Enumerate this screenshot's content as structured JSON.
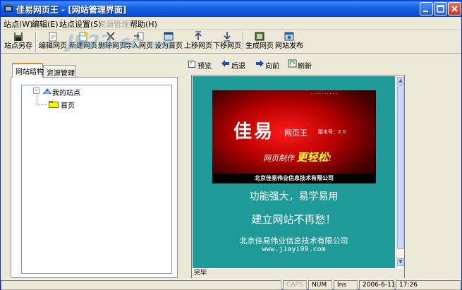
{
  "window": {
    "title": "佳易网页王 - [网站管理界面]",
    "colors": {
      "titlebar": "#0a4fd8",
      "accent": "#e68b2c",
      "preview_bg": "#1f9a98"
    }
  },
  "menu": [
    {
      "label": "站点(W)",
      "disabled": false
    },
    {
      "label": "编辑(E)",
      "disabled": false
    },
    {
      "label": "站点设置(S)",
      "disabled": false
    },
    {
      "label": "资源管理",
      "disabled": true
    },
    {
      "label": "帮助(H)",
      "disabled": false
    }
  ],
  "toolbar": [
    {
      "label": "站点另存",
      "icon": "save-site-icon"
    },
    {
      "label": "编辑网页",
      "icon": "edit-page-icon"
    },
    {
      "label": "新建网页",
      "icon": "new-page-icon"
    },
    {
      "label": "删除网页",
      "icon": "delete-page-icon"
    },
    {
      "label": "导入网页",
      "icon": "import-page-icon"
    },
    {
      "label": "设为首页",
      "icon": "set-home-icon"
    },
    {
      "label": "上移网页",
      "icon": "move-up-icon"
    },
    {
      "label": "下移网页",
      "icon": "move-down-icon"
    },
    {
      "label": "生成网页",
      "icon": "generate-page-icon"
    },
    {
      "label": "网站发布",
      "icon": "publish-site-icon"
    }
  ],
  "watermark": {
    "text": "JS22.cc",
    "sub": "软件园"
  },
  "tabs": [
    {
      "label": "网站结构",
      "active": true
    },
    {
      "label": "资源管理",
      "active": false
    }
  ],
  "tree": {
    "root": {
      "label": "我的站点",
      "expander": "-"
    },
    "children": [
      {
        "label": "首页"
      }
    ]
  },
  "preview_bar": {
    "preview_label": "预览",
    "preview_checked": true,
    "back_label": "后退",
    "forward_label": "向前",
    "refresh_label": "刷新"
  },
  "preview_page": {
    "banner_big": "佳易",
    "banner_mid": "网页王",
    "banner_version": "版本号：2.0",
    "banner_slogan_a": "网页制作",
    "banner_slogan_hot": "更轻松",
    "banner_slogan_end": "!",
    "banner_corp": "北京佳易伟业信息技术有限公司",
    "line1": "功能强大，易学易用",
    "line2": "建立网站不再愁！",
    "line3": "北京佳易伟业信息技术有限公司",
    "line4": "www.jiayi99.com",
    "status": "完毕"
  },
  "statusbar": {
    "caps": "CAPS",
    "num": "NUM",
    "ins": "Ins",
    "date": "2006-6-11",
    "time": "17:26"
  }
}
